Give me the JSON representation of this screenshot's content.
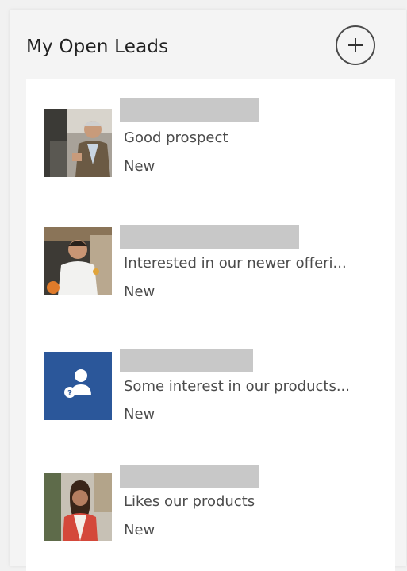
{
  "header": {
    "title": "My Open Leads",
    "add_icon": "plus-icon"
  },
  "leads": [
    {
      "description": "Good prospect",
      "status": "New",
      "avatar": "photo-man-gray-hair"
    },
    {
      "description": "Interested in our newer offeri...",
      "status": "New",
      "avatar": "photo-man-white-shirt"
    },
    {
      "description": "Some interest in our products...",
      "status": "New",
      "avatar": "unknown-contact-icon"
    },
    {
      "description": "Likes our products",
      "status": "New",
      "avatar": "photo-woman-smiling"
    }
  ],
  "colors": {
    "placeholder_tile": "#2b579a",
    "redaction": "#c8c8c8"
  }
}
